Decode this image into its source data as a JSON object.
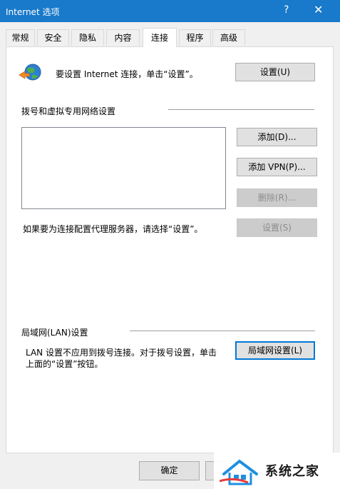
{
  "window": {
    "title": "Internet 选项",
    "help_glyph": "?",
    "close_glyph": "✕"
  },
  "tabs": [
    {
      "label": "常规"
    },
    {
      "label": "安全"
    },
    {
      "label": "隐私"
    },
    {
      "label": "内容"
    },
    {
      "label": "连接",
      "active": true
    },
    {
      "label": "程序"
    },
    {
      "label": "高级"
    }
  ],
  "setup": {
    "text": "要设置 Internet 连接，单击“设置”。",
    "button": "设置(U)"
  },
  "dialup": {
    "section_title": "拨号和虚拟专用网络设置",
    "add_button": "添加(D)...",
    "add_vpn_button": "添加 VPN(P)...",
    "delete_button": "删除(R)...",
    "proxy_text": "如果要为连接配置代理服务器，请选择“设置”。",
    "settings_button": "设置(S)"
  },
  "lan": {
    "section_title": "局域网(LAN)设置",
    "text_line1": "LAN 设置不应用到拨号连接。对于拨号设置，单击",
    "text_line2": "上面的“设置”按钮。",
    "button": "局域网设置(L)"
  },
  "footer": {
    "ok_button": "确定"
  },
  "watermark": {
    "text": "系统之家"
  },
  "colors": {
    "titlebar": "#1979ca",
    "focus": "#0078d7"
  }
}
